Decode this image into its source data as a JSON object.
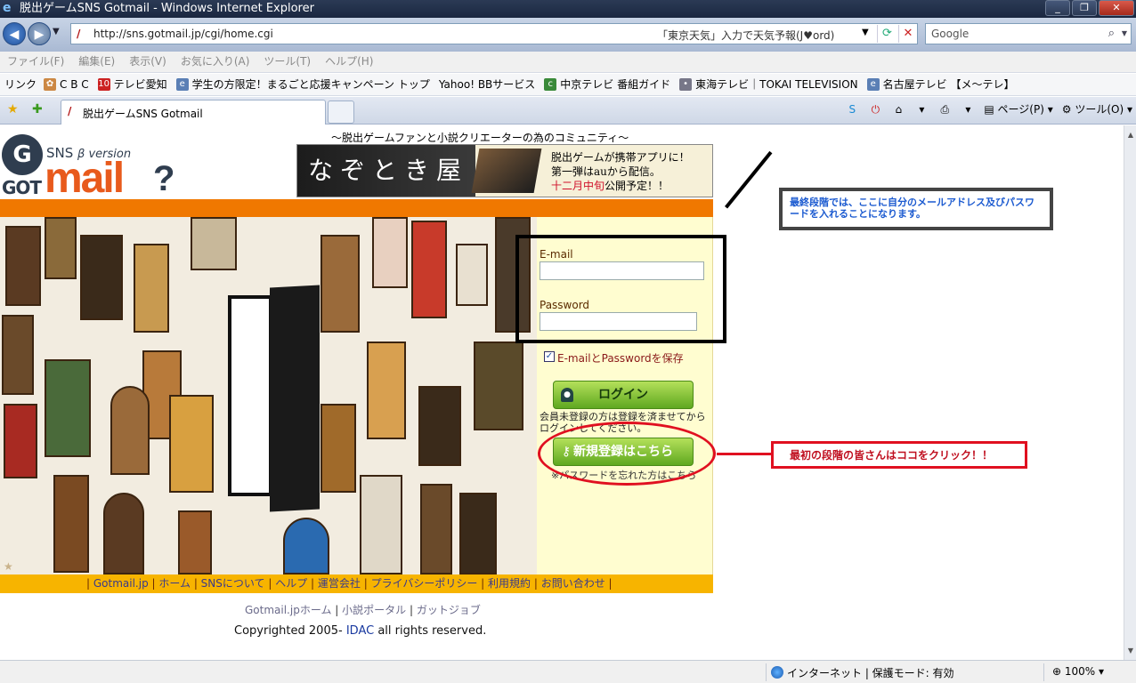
{
  "window": {
    "title": "脱出ゲームSNS Gotmail - Windows Internet Explorer",
    "buttons": [
      "_",
      "❐",
      "✕"
    ]
  },
  "address": {
    "url": "http://sns.gotmail.jp/cgi/home.cgi",
    "hint": "「東京天気」入力で天気予報(J♥ord)",
    "search_placeholder": "Google"
  },
  "menu": [
    "ファイル(F)",
    "編集(E)",
    "表示(V)",
    "お気に入り(A)",
    "ツール(T)",
    "ヘルプ(H)"
  ],
  "links_bar": {
    "label": "リンク",
    "items": [
      "C B C",
      "テレビ愛知",
      "学生の方限定！まるごと応援キャンペーン トップ",
      "Yahoo! BBサービス",
      "中京テレビ 番組ガイド",
      "東海テレビ｜TOKAI TELEVISION",
      "名古屋テレビ 【メ～テレ】"
    ]
  },
  "tab": {
    "title": "脱出ゲームSNS Gotmail"
  },
  "command_bar": {
    "page": "ページ(P)",
    "tools": "ツール(O)"
  },
  "logo": {
    "sns": "SNS",
    "version": "β version",
    "got": "GOT",
    "mail": "mail",
    "q": "?"
  },
  "header": {
    "tagline": "～脱出ゲームファンと小説クリエーターの為のコミュニティ～"
  },
  "banner": {
    "title": "なぞとき屋",
    "line1": "脱出ゲームが携帯アプリに！",
    "line2": "第一弾はauから配信。",
    "line3_red": "十二月中旬",
    "line3_rest": "公開予定！！"
  },
  "login": {
    "email_label": "E-mail",
    "email_value": "",
    "password_label": "Password",
    "password_value": "",
    "remember_label": "E-mailとPasswordを保存",
    "remember_checked": true,
    "login_button": "ログイン",
    "notice": "会員未登録の方は登録を済ませてからログインしてください。",
    "register_button": "新規登録はこちら",
    "forgot": "※パスワードを忘れた方はこちら"
  },
  "footer_nav": {
    "items": [
      "Gotmail.jp",
      "ホーム",
      "SNSについて",
      "ヘルプ",
      "運営会社",
      "プライバシーポリシー",
      "利用規約",
      "お問い合わせ"
    ]
  },
  "footer_links": {
    "items": [
      "Gotmail.jpホーム",
      "小説ポータル",
      "ガットジョブ"
    ]
  },
  "copyright": {
    "prefix": "Copyrighted 2005-",
    "company": "IDAC",
    "suffix": "all rights reserved."
  },
  "annotations": {
    "callout_top": "最終段階では、ここに自分のメールアドレス及びパスワードを入れることになります。",
    "callout_bottom": "最初の段階の皆さんはココをクリック！！"
  },
  "status": {
    "zone": "インターネット | 保護モード: 有効",
    "zoom": "100%"
  },
  "colors": {
    "orange": "#f07800",
    "footer_yellow": "#f7b400",
    "panel": "#fffdd0",
    "button_green": "#5fa820",
    "annotation_red": "#e01020"
  }
}
